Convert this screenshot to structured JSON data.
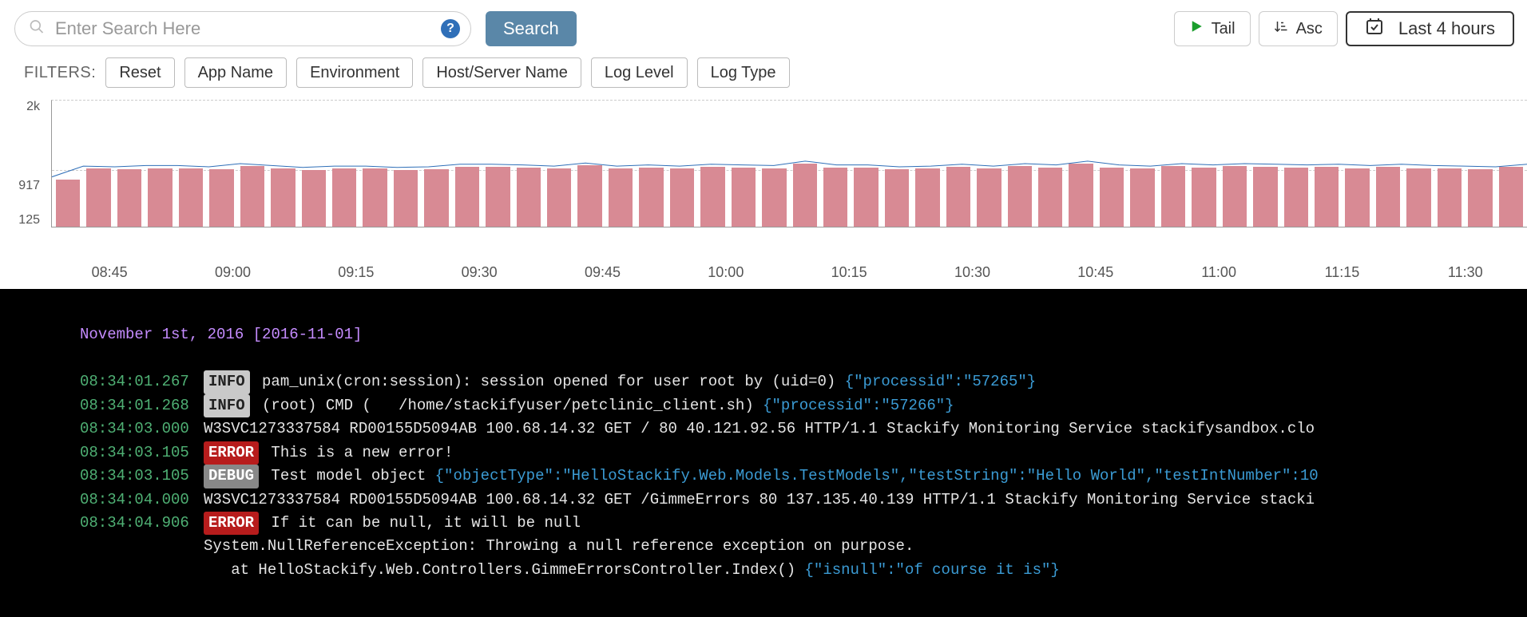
{
  "search": {
    "placeholder": "Enter Search Here",
    "button": "Search"
  },
  "toolbar": {
    "tail": "Tail",
    "asc": "Asc",
    "range": "Last 4 hours"
  },
  "filters": {
    "label": "FILTERS:",
    "reset": "Reset",
    "items": [
      "App Name",
      "Environment",
      "Host/Server Name",
      "Log Level",
      "Log Type"
    ]
  },
  "chart_data": {
    "type": "bar",
    "yticks": [
      "2k",
      "917",
      "125"
    ],
    "xticks": [
      "08:45",
      "09:00",
      "09:15",
      "09:30",
      "09:45",
      "10:00",
      "10:15",
      "10:30",
      "10:45",
      "11:00",
      "11:15",
      "11:30"
    ],
    "series": [
      {
        "name": "bars",
        "values": [
          750,
          920,
          910,
          930,
          930,
          910,
          960,
          930,
          900,
          920,
          920,
          900,
          910,
          950,
          950,
          940,
          920,
          970,
          920,
          940,
          920,
          950,
          940,
          930,
          1000,
          940,
          940,
          910,
          920,
          950,
          920,
          960,
          940,
          1000,
          940,
          920,
          960,
          940,
          960,
          950,
          940,
          950,
          930,
          950,
          930,
          920,
          910,
          950
        ]
      },
      {
        "name": "line",
        "values": [
          790,
          960,
          950,
          970,
          970,
          950,
          1000,
          970,
          940,
          960,
          960,
          940,
          950,
          990,
          990,
          980,
          960,
          1010,
          960,
          980,
          960,
          990,
          980,
          970,
          1040,
          980,
          980,
          950,
          960,
          990,
          960,
          1000,
          980,
          1040,
          980,
          960,
          1000,
          980,
          1000,
          990,
          980,
          990,
          970,
          990,
          970,
          960,
          950,
          990
        ]
      }
    ],
    "ymax": 2000
  },
  "logs": {
    "date_header": "November 1st, 2016 [2016-11-01]",
    "rows": [
      {
        "ts": "08:34:01.267",
        "lvl": "INFO",
        "msg": "pam_unix(cron:session): session opened for user root by (uid=0) ",
        "json": "{\"processid\":\"57265\"}"
      },
      {
        "ts": "08:34:01.268",
        "lvl": "INFO",
        "msg": "(root) CMD (   /home/stackifyuser/petclinic_client.sh) ",
        "json": "{\"processid\":\"57266\"}"
      },
      {
        "ts": "08:34:03.000",
        "lvl": "",
        "msg": "W3SVC1273337584 RD00155D5094AB 100.68.14.32 GET / 80 40.121.92.56 HTTP/1.1 Stackify Monitoring Service stackifysandbox.clo",
        "json": ""
      },
      {
        "ts": "08:34:03.105",
        "lvl": "ERROR",
        "msg": "This is a new error!",
        "json": ""
      },
      {
        "ts": "08:34:03.105",
        "lvl": "DEBUG",
        "msg": "Test model object ",
        "json": "{\"objectType\":\"HelloStackify.Web.Models.TestModels\",\"testString\":\"Hello World\",\"testIntNumber\":10"
      },
      {
        "ts": "08:34:04.000",
        "lvl": "",
        "msg": "W3SVC1273337584 RD00155D5094AB 100.68.14.32 GET /GimmeErrors 80 137.135.40.139 HTTP/1.1 Stackify Monitoring Service stacki",
        "json": ""
      },
      {
        "ts": "08:34:04.906",
        "lvl": "ERROR",
        "msg": "If it can be null, it will be null",
        "json": ""
      }
    ],
    "trace": [
      "System.NullReferenceException: Throwing a null reference exception on purpose.",
      "   at HelloStackify.Web.Controllers.GimmeErrorsController.Index() "
    ],
    "trace_json": "{\"isnull\":\"of course it is\"}"
  }
}
